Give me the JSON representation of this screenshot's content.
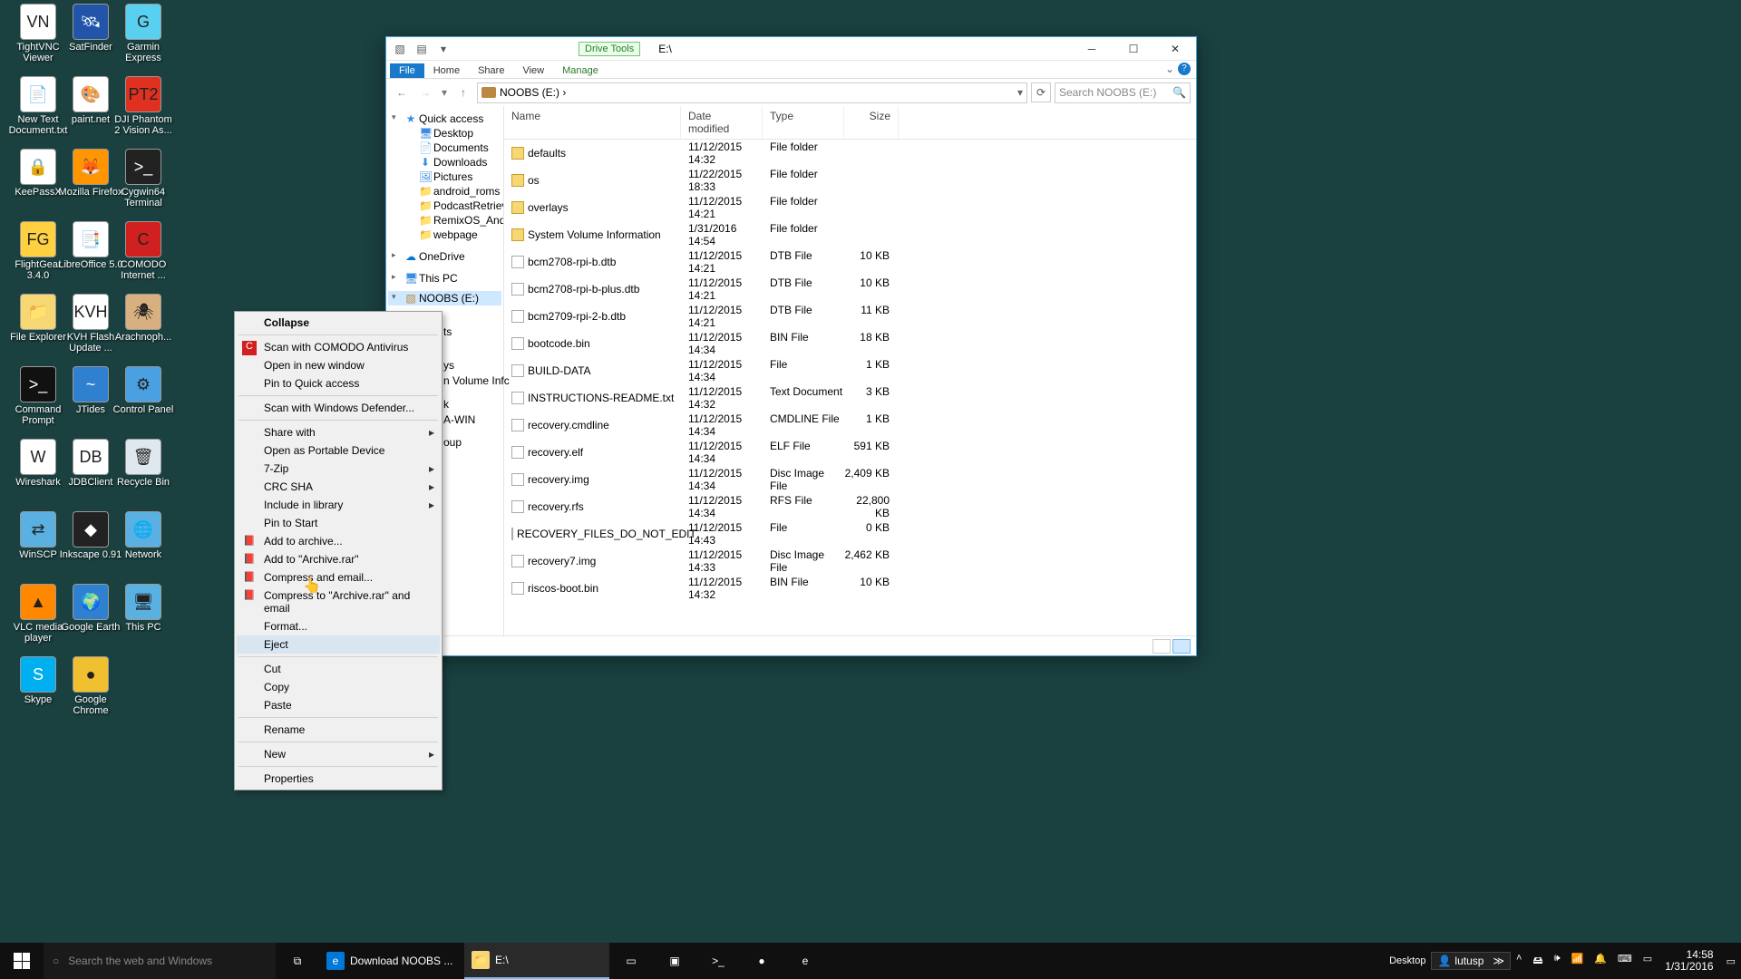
{
  "desktop_icons": [
    {
      "label": "TightVNC Viewer",
      "col": 0,
      "row": 0,
      "glyph": "VN",
      "bg": "#fff"
    },
    {
      "label": "SatFinder",
      "col": 1,
      "row": 0,
      "glyph": "🛰",
      "bg": "#2255aa"
    },
    {
      "label": "Garmin Express",
      "col": 2,
      "row": 0,
      "glyph": "G",
      "bg": "#5ad0f0"
    },
    {
      "label": "New Text Document.txt",
      "col": 0,
      "row": 1,
      "glyph": "📄",
      "bg": "#fff"
    },
    {
      "label": "paint.net",
      "col": 1,
      "row": 1,
      "glyph": "🎨",
      "bg": "#fff"
    },
    {
      "label": "DJI Phantom 2 Vision As...",
      "col": 2,
      "row": 1,
      "glyph": "PT2",
      "bg": "#e03020"
    },
    {
      "label": "KeePassX",
      "col": 0,
      "row": 2,
      "glyph": "🔒",
      "bg": "#fff"
    },
    {
      "label": "Mozilla Firefox",
      "col": 1,
      "row": 2,
      "glyph": "🦊",
      "bg": "#ff9500"
    },
    {
      "label": "Cygwin64 Terminal",
      "col": 2,
      "row": 2,
      "glyph": ">_",
      "bg": "#222"
    },
    {
      "label": "FlightGear 3.4.0",
      "col": 0,
      "row": 3,
      "glyph": "FG",
      "bg": "#ffd040"
    },
    {
      "label": "LibreOffice 5.0",
      "col": 1,
      "row": 3,
      "glyph": "📑",
      "bg": "#fff"
    },
    {
      "label": "COMODO Internet ...",
      "col": 2,
      "row": 3,
      "glyph": "C",
      "bg": "#d02020"
    },
    {
      "label": "File Explorer",
      "col": 0,
      "row": 4,
      "glyph": "📁",
      "bg": "#f7d774"
    },
    {
      "label": "KVH Flash Update ...",
      "col": 1,
      "row": 4,
      "glyph": "KVH",
      "bg": "#fff"
    },
    {
      "label": "Arachnoph...",
      "col": 2,
      "row": 4,
      "glyph": "🕷",
      "bg": "#d8b080"
    },
    {
      "label": "Command Prompt",
      "col": 0,
      "row": 5,
      "glyph": ">_",
      "bg": "#111"
    },
    {
      "label": "JTides",
      "col": 1,
      "row": 5,
      "glyph": "~",
      "bg": "#3080d0"
    },
    {
      "label": "Control Panel",
      "col": 2,
      "row": 5,
      "glyph": "⚙",
      "bg": "#4aa0e0"
    },
    {
      "label": "Wireshark",
      "col": 0,
      "row": 6,
      "glyph": "W",
      "bg": "#fff"
    },
    {
      "label": "JDBClient",
      "col": 1,
      "row": 6,
      "glyph": "DB",
      "bg": "#fff"
    },
    {
      "label": "Recycle Bin",
      "col": 2,
      "row": 6,
      "glyph": "🗑",
      "bg": "#e0e8ef"
    },
    {
      "label": "WinSCP",
      "col": 0,
      "row": 7,
      "glyph": "⇄",
      "bg": "#5ab0e0"
    },
    {
      "label": "Inkscape 0.91",
      "col": 1,
      "row": 7,
      "glyph": "◆",
      "bg": "#222"
    },
    {
      "label": "Network",
      "col": 2,
      "row": 7,
      "glyph": "🌐",
      "bg": "#5ab0e0"
    },
    {
      "label": "VLC media player",
      "col": 0,
      "row": 8,
      "glyph": "▲",
      "bg": "#ff8800"
    },
    {
      "label": "Google Earth",
      "col": 1,
      "row": 8,
      "glyph": "🌍",
      "bg": "#3080d0"
    },
    {
      "label": "This PC",
      "col": 2,
      "row": 8,
      "glyph": "🖥",
      "bg": "#5ab0e0"
    },
    {
      "label": "Skype",
      "col": 0,
      "row": 9,
      "glyph": "S",
      "bg": "#00aff0"
    },
    {
      "label": "Google Chrome",
      "col": 1,
      "row": 9,
      "glyph": "●",
      "bg": "#f0c030"
    }
  ],
  "explorer": {
    "title_path": "E:\\",
    "drive_tools": "Drive Tools",
    "tabs": {
      "file": "File",
      "home": "Home",
      "share": "Share",
      "view": "View",
      "manage": "Manage"
    },
    "breadcrumb": "NOOBS (E:)  ›",
    "search_placeholder": "Search NOOBS (E:)",
    "nav": {
      "quick": "Quick access",
      "quick_items": [
        "Desktop",
        "Documents",
        "Downloads",
        "Pictures",
        "android_roms",
        "PodcastRetriever",
        "RemixOS_Android_f",
        "webpage"
      ],
      "onedrive": "OneDrive",
      "thispc": "This PC",
      "selected": "NOOBS (E:)",
      "behind_fragments": [
        "ts",
        "ys",
        "n Volume Infc",
        "k",
        "A-WIN",
        "oup"
      ]
    },
    "columns": {
      "name": "Name",
      "date": "Date modified",
      "type": "Type",
      "size": "Size"
    },
    "files": [
      {
        "name": "defaults",
        "date": "11/12/2015 14:32",
        "type": "File folder",
        "size": "",
        "folder": true
      },
      {
        "name": "os",
        "date": "11/22/2015 18:33",
        "type": "File folder",
        "size": "",
        "folder": true
      },
      {
        "name": "overlays",
        "date": "11/12/2015 14:21",
        "type": "File folder",
        "size": "",
        "folder": true
      },
      {
        "name": "System Volume Information",
        "date": "1/31/2016 14:54",
        "type": "File folder",
        "size": "",
        "folder": true
      },
      {
        "name": "bcm2708-rpi-b.dtb",
        "date": "11/12/2015 14:21",
        "type": "DTB File",
        "size": "10 KB"
      },
      {
        "name": "bcm2708-rpi-b-plus.dtb",
        "date": "11/12/2015 14:21",
        "type": "DTB File",
        "size": "10 KB"
      },
      {
        "name": "bcm2709-rpi-2-b.dtb",
        "date": "11/12/2015 14:21",
        "type": "DTB File",
        "size": "11 KB"
      },
      {
        "name": "bootcode.bin",
        "date": "11/12/2015 14:34",
        "type": "BIN File",
        "size": "18 KB"
      },
      {
        "name": "BUILD-DATA",
        "date": "11/12/2015 14:34",
        "type": "File",
        "size": "1 KB"
      },
      {
        "name": "INSTRUCTIONS-README.txt",
        "date": "11/12/2015 14:32",
        "type": "Text Document",
        "size": "3 KB"
      },
      {
        "name": "recovery.cmdline",
        "date": "11/12/2015 14:34",
        "type": "CMDLINE File",
        "size": "1 KB"
      },
      {
        "name": "recovery.elf",
        "date": "11/12/2015 14:34",
        "type": "ELF File",
        "size": "591 KB"
      },
      {
        "name": "recovery.img",
        "date": "11/12/2015 14:34",
        "type": "Disc Image File",
        "size": "2,409 KB"
      },
      {
        "name": "recovery.rfs",
        "date": "11/12/2015 14:34",
        "type": "RFS File",
        "size": "22,800 KB"
      },
      {
        "name": "RECOVERY_FILES_DO_NOT_EDIT",
        "date": "11/12/2015 14:43",
        "type": "File",
        "size": "0 KB"
      },
      {
        "name": "recovery7.img",
        "date": "11/12/2015 14:33",
        "type": "Disc Image File",
        "size": "2,462 KB"
      },
      {
        "name": "riscos-boot.bin",
        "date": "11/12/2015 14:32",
        "type": "BIN File",
        "size": "10 KB"
      }
    ]
  },
  "context_menu": [
    {
      "label": "Collapse",
      "bold": true
    },
    {
      "sep": true
    },
    {
      "label": "Scan with COMODO Antivirus",
      "icon": "C",
      "iconbg": "#d02020"
    },
    {
      "label": "Open in new window"
    },
    {
      "label": "Pin to Quick access"
    },
    {
      "sep": true
    },
    {
      "label": "Scan with Windows Defender..."
    },
    {
      "sep": true
    },
    {
      "label": "Share with",
      "sub": true
    },
    {
      "label": "Open as Portable Device"
    },
    {
      "label": "7-Zip",
      "sub": true
    },
    {
      "label": "CRC SHA",
      "sub": true
    },
    {
      "label": "Include in library",
      "sub": true
    },
    {
      "label": "Pin to Start"
    },
    {
      "label": "Add to archive...",
      "icon": "📕"
    },
    {
      "label": "Add to \"Archive.rar\"",
      "icon": "📕"
    },
    {
      "label": "Compress and email...",
      "icon": "📕"
    },
    {
      "label": "Compress to \"Archive.rar\" and email",
      "icon": "📕"
    },
    {
      "label": "Format..."
    },
    {
      "label": "Eject",
      "hover": true
    },
    {
      "sep": true
    },
    {
      "label": "Cut"
    },
    {
      "label": "Copy"
    },
    {
      "label": "Paste"
    },
    {
      "sep": true
    },
    {
      "label": "Rename"
    },
    {
      "sep": true
    },
    {
      "label": "New",
      "sub": true
    },
    {
      "sep": true
    },
    {
      "label": "Properties"
    }
  ],
  "taskbar": {
    "search_placeholder": "Search the web and Windows",
    "tasks": [
      {
        "label": "Download NOOBS ...",
        "icon": "e",
        "bg": "#0078d7"
      },
      {
        "label": "E:\\",
        "icon": "📁",
        "bg": "#f7d774",
        "active": true
      }
    ],
    "pinned_glyphs": [
      "▭",
      "▣",
      ">_",
      "●",
      "e"
    ],
    "desktop_label": "Desktop",
    "user": "lutusp",
    "time": "14:58",
    "date": "1/31/2016",
    "tray_glyphs": [
      "˄",
      "🖴",
      "🕪",
      "📶",
      "🔔",
      "⌨",
      "▭"
    ]
  }
}
